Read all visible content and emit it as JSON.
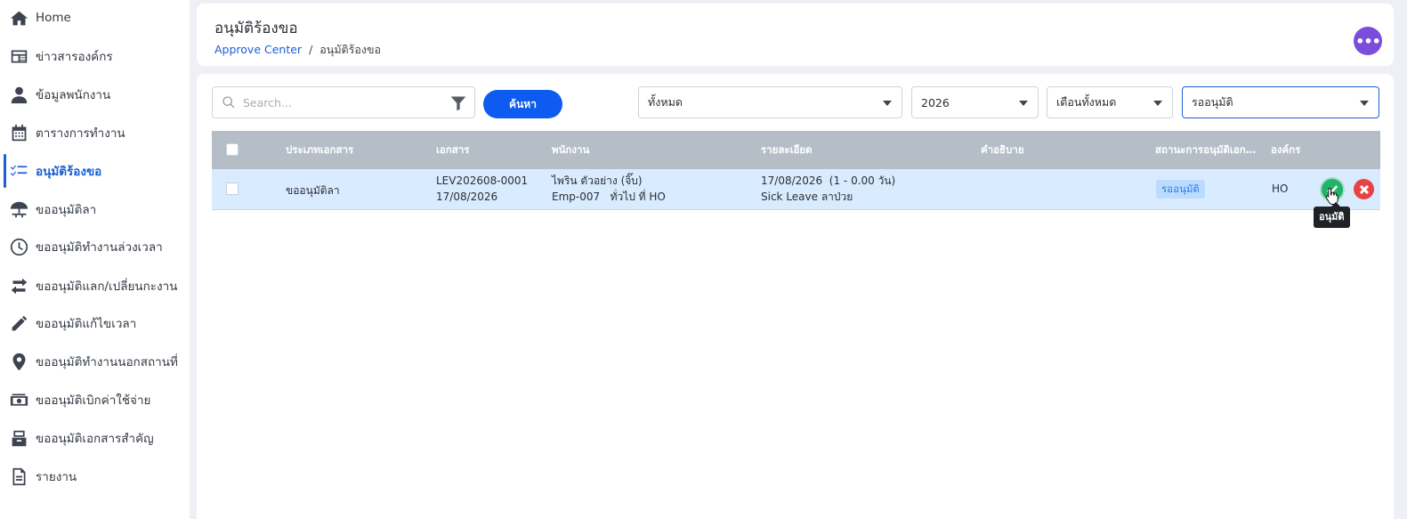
{
  "sidebar": {
    "items": [
      {
        "label": "Home",
        "icon": "home-icon"
      },
      {
        "label": "ข่าวสารองค์กร",
        "icon": "news-icon"
      },
      {
        "label": "ข้อมูลพนักงาน",
        "icon": "user-icon"
      },
      {
        "label": "ตารางการทำงาน",
        "icon": "calendar-icon"
      },
      {
        "label": "อนุมัติร้องขอ",
        "icon": "checklist-icon",
        "active": true
      },
      {
        "label": "ขออนุมัติลา",
        "icon": "beach-umbrella-icon"
      },
      {
        "label": "ขออนุมัติทำงานล่วงเวลา",
        "icon": "clock-icon"
      },
      {
        "label": "ขออนุมัติแลก/เปลี่ยนกะงาน",
        "icon": "swap-icon"
      },
      {
        "label": "ขออนุมัติแก้ไขเวลา",
        "icon": "pencil-icon"
      },
      {
        "label": "ขออนุมัติทำงานนอกสถานที่",
        "icon": "map-pin-icon"
      },
      {
        "label": "ขออนุมัติเบิกค่าใช้จ่าย",
        "icon": "money-icon"
      },
      {
        "label": "ขออนุมัติเอกสารสำคัญ",
        "icon": "document-box-icon"
      },
      {
        "label": "รายงาน",
        "icon": "report-icon"
      }
    ]
  },
  "header": {
    "title": "อนุมัติร้องขอ",
    "breadcrumb_link": "Approve Center",
    "breadcrumb_sep": "/",
    "breadcrumb_current": "อนุมัติร้องขอ",
    "more_label": "•••"
  },
  "filters": {
    "search_placeholder": "Search...",
    "search_button": "ค้นหา",
    "type_select": "ทั้งหมด",
    "year_select": "2026",
    "month_select": "เดือนทั้งหมด",
    "status_select": "รออนุมัติ"
  },
  "table": {
    "columns": [
      "ประเภทเอกสาร",
      "เอกสาร",
      "พนักงาน",
      "รายละเอียด",
      "คำอธิบาย",
      "สถานะการอนุมัติเอกสาร",
      "องค์กร"
    ],
    "rows": [
      {
        "type": "ขออนุมัติลา",
        "doc_no": "LEV202608-0001",
        "doc_date": "17/08/2026",
        "employee_name": "ไพริน ตัวอย่าง (จิ๊บ)",
        "employee_info": "Emp-007   ทั่วไป ที่ HO",
        "detail_date": "17/08/2026  (1 - 0.00 วัน)",
        "detail_type": "Sick Leave ลาป่วย",
        "description": "",
        "status": "รออนุมัติ",
        "org": "HO"
      }
    ]
  },
  "tooltip": {
    "approve": "อนุมัติ"
  },
  "colors": {
    "accent": "#1a5fd6",
    "approve": "#21b36c",
    "reject": "#e84343",
    "more": "#7b4ddb"
  }
}
